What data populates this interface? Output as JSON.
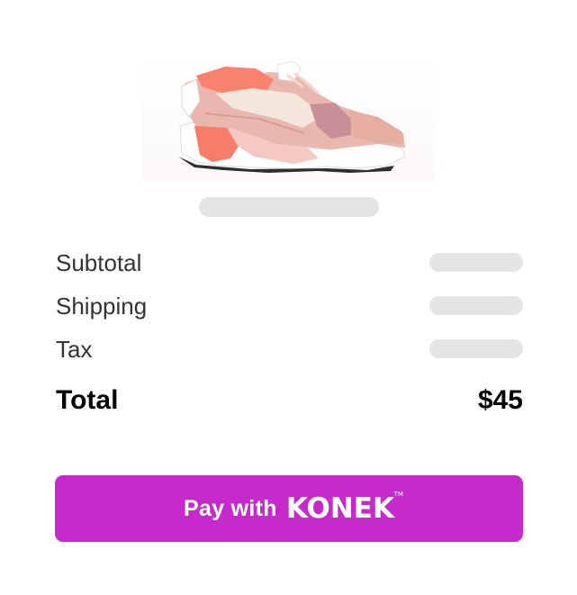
{
  "product": {
    "image_alt": "pink and coral sneaker"
  },
  "summary": {
    "subtotal_label": "Subtotal",
    "shipping_label": "Shipping",
    "tax_label": "Tax",
    "total_label": "Total",
    "total_value": "$45"
  },
  "pay_button": {
    "prefix": "Pay with",
    "brand": "KONEK",
    "trademark": "TM"
  },
  "colors": {
    "accent": "#c62acb",
    "skeleton": "#e4e4e4",
    "text": "#333333"
  }
}
